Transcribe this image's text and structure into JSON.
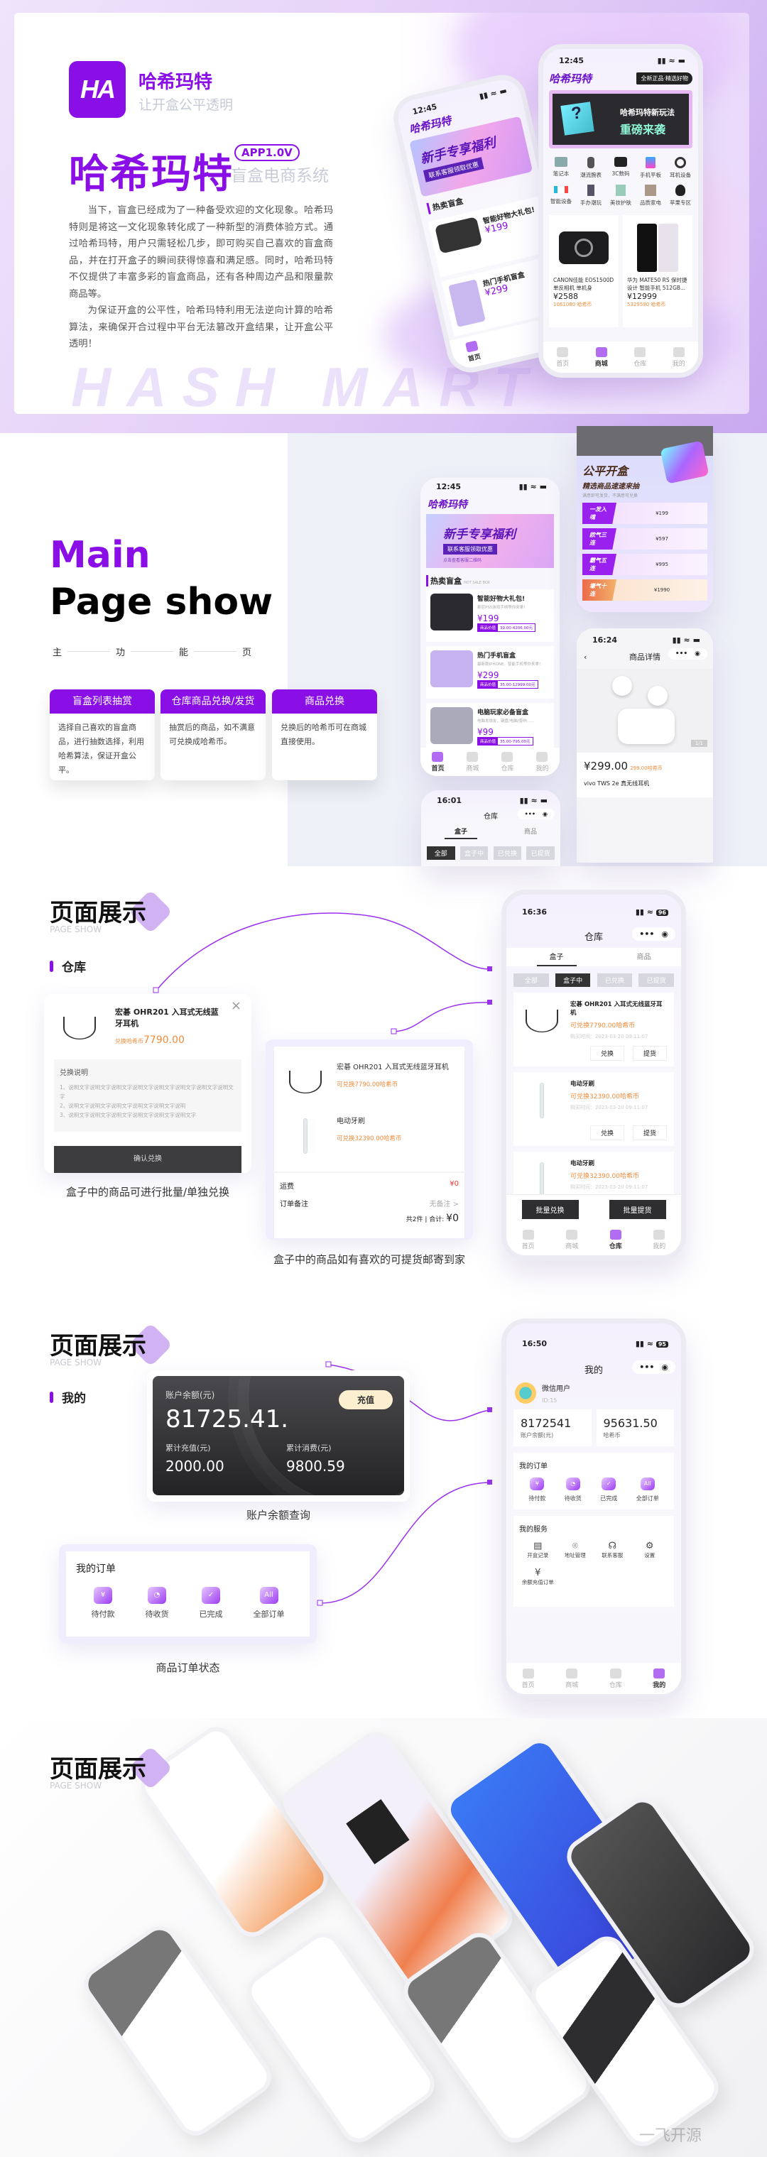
{
  "hero": {
    "logo_mark": "HA",
    "brand": "哈希玛特",
    "slogan": "让开盒公平透明",
    "title": "哈希玛特",
    "version": "APP1.0V",
    "subtitle": "盲盒电商系统",
    "paragraphs": [
      "当下，盲盒已经成为了一种备受欢迎的文化现象。哈希玛特则是将这一文化现象转化成了一种新型的消费体验方式。通过哈希玛特，用户只需轻松几步，即可购买自己喜欢的盲盒商品，并在打开盒子的瞬间获得惊喜和满足感。同时，哈希玛特不仅提供了丰富多彩的盲盒商品，还有各种周边产品和限量款商品等。",
      "为保证开盒的公平性，哈希玛特利用无法逆向计算的哈希算法，来确保开合过程中平台无法篡改开盒结果，让开盒公平透明！"
    ],
    "bg_text": "HASH MART",
    "phone_back": {
      "time": "12:45",
      "logo": "哈希玛特",
      "banner_title": "新手专享福利",
      "banner_sub": "联系客服领取优惠",
      "section": "热卖盲盒",
      "item": "智能好物大礼包!",
      "price": "¥199",
      "item2": "热门手机盲盒",
      "price2": "¥299",
      "tab": "首页"
    },
    "phone_front": {
      "time": "12:45",
      "logo": "哈希玛特",
      "tag": "全新正品·精选好物",
      "banner_title": "哈希玛特新玩法",
      "banner_sub": "重磅来袭",
      "categories": [
        "笔记本",
        "潮流腕表",
        "3C数码",
        "手机平板",
        "耳机设备",
        "智能设备",
        "手办潮玩",
        "美妆护肤",
        "品质家电",
        "苹果专区"
      ],
      "products": [
        {
          "name": "CANON佳能 EOS1500D 单反相机 单机身",
          "price": "¥2588",
          "coins": "1061080",
          "coin_unit": "哈希币"
        },
        {
          "name": "华为 MATE50 RS 保时捷设计 智能手机 512GB...",
          "price": "¥12999",
          "coins": "5329590",
          "coin_unit": "哈希币"
        }
      ]
    }
  },
  "tabbar": [
    "首页",
    "商城",
    "仓库",
    "我的"
  ],
  "main": {
    "word1": "Main",
    "word2": "Page show",
    "chars": [
      "主",
      "功",
      "能",
      "页"
    ],
    "cards": [
      {
        "title": "盲盒列表抽赏",
        "desc": "选择自己喜欢的盲盒商品，进行抽数选择，利用哈希算法，保证开盒公平。"
      },
      {
        "title": "仓库商品兑换/发货",
        "desc": "抽赏后的商品，如不满意可兑换成哈希币。"
      },
      {
        "title": "商品兑换",
        "desc": "兑换后的哈希币可在商城直接使用。"
      }
    ],
    "phone_home": {
      "time": "12:45",
      "logo": "哈希玛特",
      "banner_title": "新手专享福利",
      "banner_sub": "联系客服领取优惠",
      "banner_note": "点击查看客服二维码",
      "section_title": "热卖盲盒",
      "section_en": "HOT SALE BOX",
      "value_label": "商品价值",
      "items": [
        {
          "name": "智能好物大礼包!",
          "desc": "索尼PS5游戏手柄等你来拿!",
          "price": "¥199",
          "range": "39.00-4206.00元"
        },
        {
          "name": "热门手机盲盒",
          "desc": "最新款IPHONE、智能手机等你来拿!",
          "price": "¥299",
          "range": "35.00-12999.00元"
        },
        {
          "name": "电脑玩家必备盲盒",
          "desc": "电脑发烧友，键盘/电脑/音响......",
          "price": "¥99",
          "range": "35.00-795.00元"
        }
      ]
    },
    "phone_fair": {
      "title": "公平开盒",
      "sub": "精选商品速速来抽",
      "note": "满意即可发货，不满意可兑换",
      "tiers": [
        {
          "label": "一发入魂",
          "price": "¥199"
        },
        {
          "label": "欧气三连",
          "price": "¥597"
        },
        {
          "label": "霸气五连",
          "price": "¥995"
        },
        {
          "label": "壕气十连",
          "price": "¥1990"
        }
      ]
    },
    "phone_detail": {
      "time": "16:24",
      "title": "商品详情",
      "pager": "1/1",
      "price": "¥299.00",
      "coins": "299.00哈希币",
      "name": "vivo TWS 2e 真无线耳机"
    },
    "phone_small": {
      "time": "16:01",
      "title": "仓库",
      "tabs": [
        "盒子",
        "商品"
      ],
      "filters": [
        "全部",
        "盒子中",
        "已兑换",
        "已提货"
      ]
    }
  },
  "warehouse": {
    "title": "页面展示",
    "en": "PAGE SHOW",
    "label": "仓库",
    "exchange_card": {
      "name": "宏碁 OHR201 入耳式无线蓝牙耳机",
      "price_label": "兑换哈希币",
      "price": "7790.00",
      "notes_title": "兑换说明",
      "notes": [
        "1、说明文字说明文字说明文字说明文字说明文字说明文字说明文字说明文字",
        "2、说明文字说明文字说明文字说明文字说明文字说明",
        "3、说明文字说明文字说明文字说明文字说明文字说明文字"
      ],
      "button": "确认兑换"
    },
    "caption1": "盒子中的商品可进行批量/单独兑换",
    "ship_card": {
      "items": [
        {
          "name": "宏碁 OHR201 入耳式无线蓝牙耳机",
          "coins": "可兑换7790.00哈希币"
        },
        {
          "name": "电动牙刷",
          "coins": "可兑换32390.00哈希币"
        }
      ],
      "shipping_label": "运费",
      "shipping": "¥0",
      "remark_label": "订单备注",
      "remark": "无备注 >",
      "total_label": "共2件 | 合计:",
      "total": "¥0"
    },
    "caption2": "盒子中的商品如有喜欢的可提货邮寄到家",
    "phone": {
      "time": "16:36",
      "battery": "96",
      "title": "仓库",
      "tabs": [
        "盒子",
        "商品"
      ],
      "filters": [
        "全部",
        "盒子中",
        "已兑换",
        "已提货"
      ],
      "items": [
        {
          "name": "宏碁 OHR201 入耳式无线蓝牙耳机",
          "coins": "可兑换7790.00哈希币",
          "time": "购买时间：2023-03-20 09:11:07"
        },
        {
          "name": "电动牙刷",
          "coins": "可兑换32390.00哈希币",
          "time": "购买时间：2023-03-20 09:11:07"
        },
        {
          "name": "电动牙刷",
          "coins": "可兑换32390.00哈希币",
          "time": "购买时间：2023-03-20 09:11:07"
        }
      ],
      "exchange": "兑换",
      "pickup": "提货",
      "batch_exchange": "批量兑换",
      "batch_pickup": "批量提货"
    }
  },
  "mine": {
    "title": "页面展示",
    "en": "PAGE SHOW",
    "label": "我的",
    "balance_card": {
      "label": "账户余额(元)",
      "value": "81725.41.",
      "button": "充值",
      "recharge_label": "累计充值(元)",
      "recharge": "2000.00",
      "spend_label": "累计消费(元)",
      "spend": "9800.59"
    },
    "caption1": "账户余额查询",
    "orders_card": {
      "title": "我的订单",
      "items": [
        "待付款",
        "待收货",
        "已完成",
        "全部订单"
      ],
      "icons": [
        "¥",
        "◔",
        "✓",
        "All"
      ]
    },
    "caption2": "商品订单状态",
    "phone": {
      "time": "16:50",
      "battery": "95",
      "title": "我的",
      "user": "微信用户",
      "id": "ID:15",
      "stats": [
        {
          "value": "8172541",
          "label": "账户余额(元)"
        },
        {
          "value": "95631.50",
          "label": "哈希币"
        }
      ],
      "orders_title": "我的订单",
      "services_title": "我的服务",
      "services": [
        "开盒记录",
        "地址管理",
        "联系客服",
        "设置",
        "余额充值订单"
      ]
    }
  },
  "gallery": {
    "title": "页面展示",
    "en": "PAGE SHOW",
    "watermark": "一飞开源"
  },
  "colors": {
    "brand": "#8a0fe6",
    "accent_orange": "#f08b3a",
    "dark": "#2e2e30"
  }
}
